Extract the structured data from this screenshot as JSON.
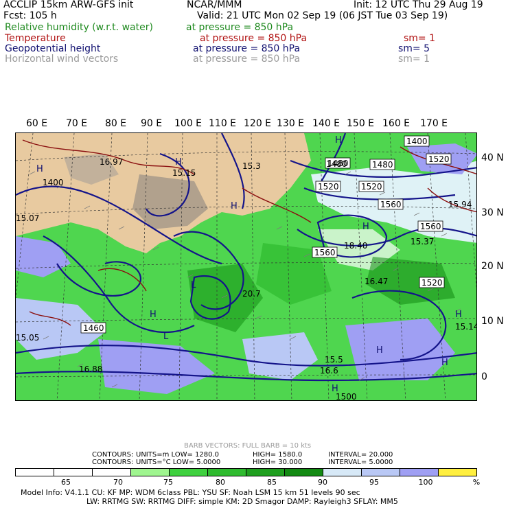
{
  "header": {
    "line1_left": "ACCLIP 15km ARW-GFS init",
    "line1_center": "NCAR/MMM",
    "line1_right": "Init: 12 UTC Thu 29 Aug 19",
    "fcst": "Fcst:  105 h",
    "valid": "Valid: 21 UTC Mon 02 Sep 19 (06 JST Tue 03 Sep 19)"
  },
  "fields": [
    {
      "name": "Relative humidity (w.r.t. water)",
      "pressure": "at pressure =  850 hPa",
      "sm": "",
      "color": "#1f8a1f"
    },
    {
      "name": "Temperature",
      "pressure": "at pressure =  850 hPa",
      "sm": "sm= 1",
      "color": "#b01010"
    },
    {
      "name": "Geopotential height",
      "pressure": "at pressure =  850 hPa",
      "sm": "sm= 5",
      "color": "#101070"
    },
    {
      "name": "Horizontal wind vectors",
      "pressure": "at pressure =  850 hPa",
      "sm": "sm= 1",
      "color": "#9a9a9a"
    }
  ],
  "map": {
    "lon_labels": [
      "60 E",
      "70 E",
      "80 E",
      "90 E",
      "100 E",
      "110 E",
      "120 E",
      "130 E",
      "140 E",
      "150 E",
      "160 E",
      "170 E"
    ],
    "lat_labels": [
      "40 N",
      "30 N",
      "20 N",
      "10 N",
      "0"
    ],
    "height_labels": [
      {
        "text": "1400"
      },
      {
        "text": "1480"
      },
      {
        "text": "1480"
      },
      {
        "text": "1520"
      },
      {
        "text": "1520"
      },
      {
        "text": "1520"
      },
      {
        "text": "1560"
      },
      {
        "text": "1560"
      },
      {
        "text": "1560"
      },
      {
        "text": "1520"
      },
      {
        "text": "1460"
      },
      {
        "text": "1400"
      },
      {
        "text": "1480"
      },
      {
        "text": "1500"
      }
    ],
    "temp_labels": [
      {
        "text": "16.97"
      },
      {
        "text": "15.15"
      },
      {
        "text": "15.3"
      },
      {
        "text": "15.5"
      },
      {
        "text": "18.40"
      },
      {
        "text": "15.37"
      },
      {
        "text": "16.47"
      },
      {
        "text": "16.88"
      },
      {
        "text": "16.6"
      },
      {
        "text": "15.14"
      },
      {
        "text": "20.7"
      },
      {
        "text": "15.05"
      },
      {
        "text": "15.07"
      },
      {
        "text": "15.94"
      }
    ],
    "hl_labels": [
      "H",
      "H",
      "H",
      "H",
      "H",
      "H",
      "L",
      "H",
      "H",
      "L",
      "H",
      "H"
    ]
  },
  "footer": {
    "barb": "BARB VECTORS:  FULL BARB = 10 kts",
    "contours1_label": "CONTOURS:",
    "contours1": "UNITS=m    LOW=  1280.0",
    "contours1_high": "HIGH=  1580.0",
    "contours1_int": "INTERVAL=     20.000",
    "contours2_label": "CONTOURS:",
    "contours2": "UNITS=°C   LOW=    5.0000",
    "contours2_high": "HIGH=   30.000",
    "contours2_int": "INTERVAL=     5.0000"
  },
  "scale": {
    "ticks": [
      "65",
      "70",
      "75",
      "80",
      "85",
      "90",
      "95",
      "100",
      "%"
    ],
    "colors": [
      "#ffffff",
      "#ffffff",
      "#ffffff",
      "#9ff58f",
      "#3fd13f",
      "#2fbb2f",
      "#1f9f1f",
      "#138a13",
      "#d7e9f7",
      "#b9c8f5",
      "#9f9ff3",
      "#ffef3f"
    ]
  },
  "model": {
    "line1": "Model Info: V4.1.1     CU: KF       MP: WDM 6class   PBL: YSU          SF: Noah LSM      15 km     51 levels    90 sec",
    "line2": "LW: RRTMG    SW: RRTMG   DIFF: simple  KM: 2D Smagor  DAMP: Rayleigh3  SFLAY: MM5"
  }
}
